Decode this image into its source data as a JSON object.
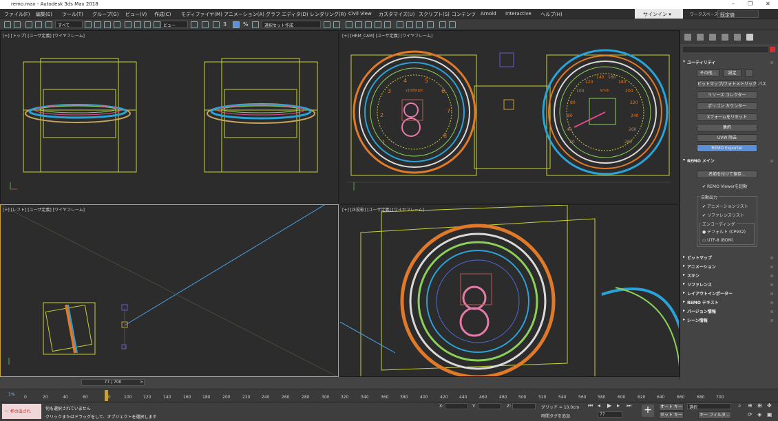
{
  "window": {
    "title": "remo.max - Autodesk 3ds Max 2018"
  },
  "menu": [
    "ファイル(F)",
    "編集(E)",
    "ツール(T)",
    "グループ(G)",
    "ビュー(V)",
    "作成(C)",
    "モディファイヤ(M)",
    "アニメーション(A)",
    "グラフ エディタ(D)",
    "レンダリング(R)",
    "Civil View",
    "カスタマイズ(U)",
    "スクリプト(S)",
    "コンテンツ",
    "Arnold",
    "Interactive",
    "ヘルプ(H)"
  ],
  "account": {
    "signin": "サインイン",
    "workspace_label": "ワークスペース:",
    "workspace_value": "既定値"
  },
  "toolbar": {
    "filter": "すべて",
    "coordsys": "ビュー",
    "selset": "選択セット作成",
    "snap_num": "3",
    "snap_pct": "%"
  },
  "viewports": {
    "top": "[+] [トップ] [ユーザ定義] [ワイヤフレーム]",
    "camera": "[+] [HRM_CAM] [ユーザ定義] [ワイヤフレーム]",
    "left": "[+] [レフト] [ユーザ定義] [ワイヤフレーム]",
    "persp": "[+] [正投影] [ユーザ定義] [ワイヤフレーム]"
  },
  "gauges": {
    "tach_unit": "x1000rpm",
    "speed_unit": "km/h",
    "tach_numbers": [
      "1",
      "2",
      "3",
      "4",
      "5",
      "6",
      "7",
      "8"
    ],
    "speed_numbers": [
      "20",
      "40",
      "60",
      "80",
      "100",
      "120",
      "140",
      "160",
      "180",
      "200",
      "220",
      "240",
      "260",
      "280"
    ]
  },
  "cmdpanel": {
    "utility_title": "ユーティリティ",
    "more": "その他...",
    "sets": "設定",
    "buttons": [
      "ビットマップ/フォトメトリック パス",
      "リソース コレクター",
      "ポリゴン カウンター",
      "Xフォームをリセット",
      "集約",
      "UVW 除去",
      "REMO Exporter"
    ],
    "remo_main": "REMO メイン",
    "save_as": "名前を付けて保存...",
    "start_viewer": "REMO Viewerを起動",
    "auto_output": "自動出力",
    "anim_list": "アニメーションリスト",
    "ref_list": "リファレンスリスト",
    "encoding": "エンコーディング",
    "enc_default": "デフォルト (CP932)",
    "enc_utf8": "UTF-8 (BOM)",
    "rollouts": [
      "ビットマップ",
      "アニメーション",
      "スキン",
      "リファレンス",
      "レイアウトインポーター",
      "REMO テキスト",
      "バージョン情報",
      "シーン情報"
    ]
  },
  "timeline": {
    "frame": "77 / 700",
    "ticks": [
      "0",
      "20",
      "40",
      "60",
      "80",
      "100",
      "120",
      "140",
      "160",
      "180",
      "200",
      "220",
      "240",
      "260",
      "280",
      "300",
      "320",
      "340",
      "360",
      "380",
      "400",
      "420",
      "440",
      "460",
      "480",
      "500",
      "520",
      "540",
      "560",
      "580",
      "600",
      "620",
      "640",
      "660",
      "680",
      "700"
    ],
    "pct": "1%"
  },
  "status": {
    "maxscript": "一 杯の出され",
    "line1": "何も選択されていません",
    "line2": "クリックまたはドラッグをして、オブジェクトを選択します",
    "x": "X:",
    "y": "Y:",
    "z": "Z:",
    "grid": "グリッド = 10.0cm",
    "add_tag": "時間タグを追加",
    "autokey": "オート キー",
    "setkey": "セット キー",
    "select_val": "選択",
    "keyfilter": "キー フィルタ...",
    "frame": "77"
  },
  "colors": {
    "viewport_bg": "#2c2c2c",
    "active_border": "#c8a23a",
    "highlight_btn": "#5b8fd8"
  }
}
